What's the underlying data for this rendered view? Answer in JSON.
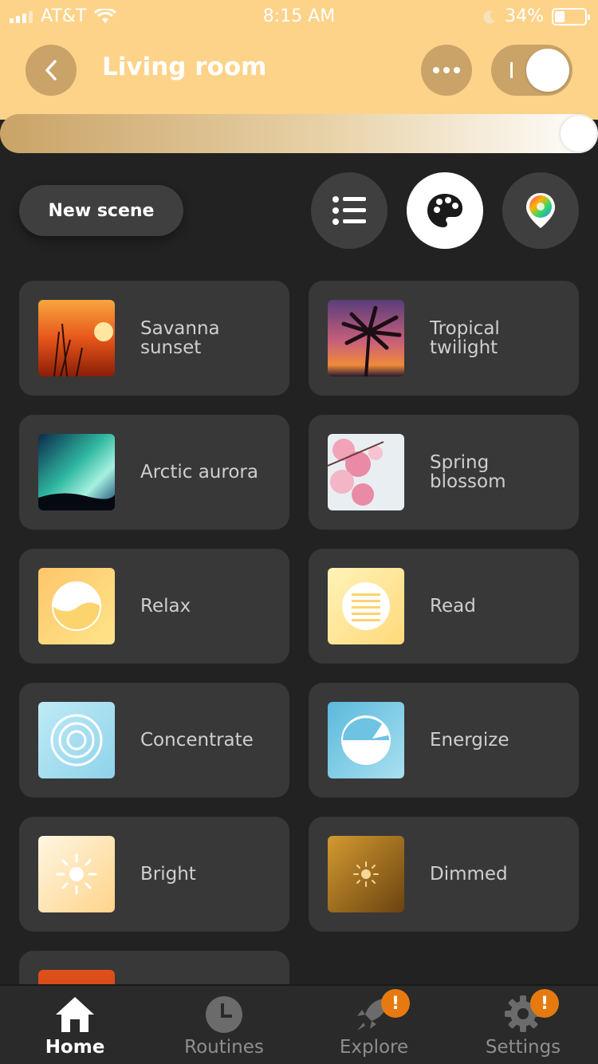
{
  "status_bar": {
    "carrier": "AT&T",
    "time": "8:15 AM",
    "battery": "34%",
    "battery_level": 0.34
  },
  "header": {
    "title": "Living room",
    "power_on": true,
    "brightness_level": 1.0
  },
  "toolbar": {
    "new_scene_label": "New scene",
    "active_view": "palette"
  },
  "scenes": [
    {
      "name": "Savanna sunset",
      "thumb": "photo-sunset"
    },
    {
      "name": "Tropical twilight",
      "thumb": "photo-palm"
    },
    {
      "name": "Arctic aurora",
      "thumb": "photo-aurora"
    },
    {
      "name": "Spring blossom",
      "thumb": "photo-blossom"
    },
    {
      "name": "Relax",
      "thumb": "relax-icon"
    },
    {
      "name": "Read",
      "thumb": "read-icon"
    },
    {
      "name": "Concentrate",
      "thumb": "concentrate-icon"
    },
    {
      "name": "Energize",
      "thumb": "energize-icon"
    },
    {
      "name": "Bright",
      "thumb": "bright-sun-icon"
    },
    {
      "name": "Dimmed",
      "thumb": "dimmed-sun-icon"
    }
  ],
  "tabs": [
    {
      "label": "Home",
      "icon": "home-icon",
      "active": true
    },
    {
      "label": "Routines",
      "icon": "clock-icon",
      "active": false
    },
    {
      "label": "Explore",
      "icon": "rocket-icon",
      "active": false,
      "badge": "!"
    },
    {
      "label": "Settings",
      "icon": "gear-icon",
      "active": false,
      "badge": "!"
    }
  ],
  "colors": {
    "header": "#fdd38a",
    "background": "#222222",
    "card": "#383838",
    "badge": "#e67a10"
  }
}
